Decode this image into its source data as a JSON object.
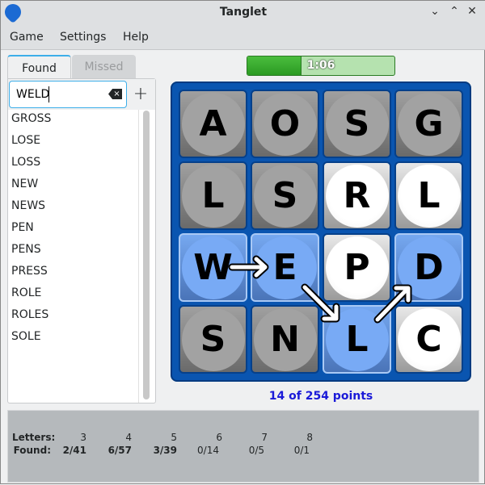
{
  "window": {
    "title": "Tanglet",
    "controls": [
      "minimize",
      "maximize",
      "close"
    ]
  },
  "menu": [
    "Game",
    "Settings",
    "Help"
  ],
  "tabs": {
    "found": "Found",
    "missed": "Missed"
  },
  "input": {
    "value": "WELD"
  },
  "found_words": [
    "GROSS",
    "LOSE",
    "LOSS",
    "NEW",
    "NEWS",
    "PEN",
    "PENS",
    "PRESS",
    "ROLE",
    "ROLES",
    "SOLE"
  ],
  "timer": {
    "text": "1:06",
    "fraction_remaining": 0.37,
    "color": "#2a9a22"
  },
  "board": {
    "letters": [
      [
        "A",
        "O",
        "S",
        "G"
      ],
      [
        "L",
        "S",
        "R",
        "L"
      ],
      [
        "W",
        "E",
        "P",
        "D"
      ],
      [
        "S",
        "N",
        "L",
        "C"
      ]
    ],
    "states": [
      [
        "gray",
        "gray",
        "gray",
        "gray"
      ],
      [
        "gray",
        "gray",
        "white",
        "white"
      ],
      [
        "blue",
        "blue",
        "white",
        "blue"
      ],
      [
        "gray",
        "gray",
        "blue",
        "white"
      ]
    ],
    "path": [
      "W",
      "E",
      "L",
      "D"
    ]
  },
  "score": "14 of 254 points",
  "stats": {
    "letters_label": "Letters:",
    "found_label": "Found:",
    "lengths": [
      "3",
      "4",
      "5",
      "6",
      "7",
      "8"
    ],
    "found": [
      "2/41",
      "6/57",
      "3/39",
      "0/14",
      "0/5",
      "0/1"
    ],
    "bold": [
      true,
      true,
      true,
      false,
      false,
      false
    ]
  }
}
